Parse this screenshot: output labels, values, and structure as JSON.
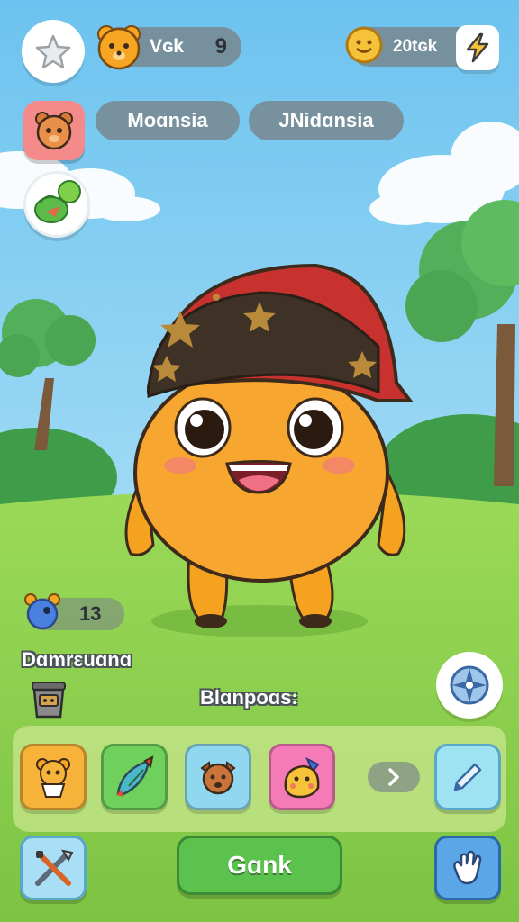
{
  "top_bar": {
    "coins_label": "Vɢk",
    "coins_value": "9",
    "gems_value": "20tɢk"
  },
  "name_tags": {
    "pet_name": "Moɑnsia",
    "owner_name": "JNidɑnsia"
  },
  "stat": {
    "value": "13"
  },
  "labels": {
    "section_title": "Dɑmrɛuɑnɑ",
    "center_caption": "Blɑnpoɑs:"
  },
  "inventory": {
    "items": [
      "bear-toy-icon",
      "rocket-toy-icon",
      "puppy-toy-icon",
      "chick-toy-icon"
    ],
    "next_icon": "chevron-right-icon"
  },
  "actions": {
    "go_label": "Gɑnk"
  },
  "colors": {
    "sky": "#8ed0f2",
    "grass": "#8fd24f",
    "pet_body": "#f7a630",
    "cap": "#c8322e",
    "go_button": "#5cc24e",
    "edit_button": "#9fe3f3",
    "hand_button": "#5aa6e6"
  }
}
